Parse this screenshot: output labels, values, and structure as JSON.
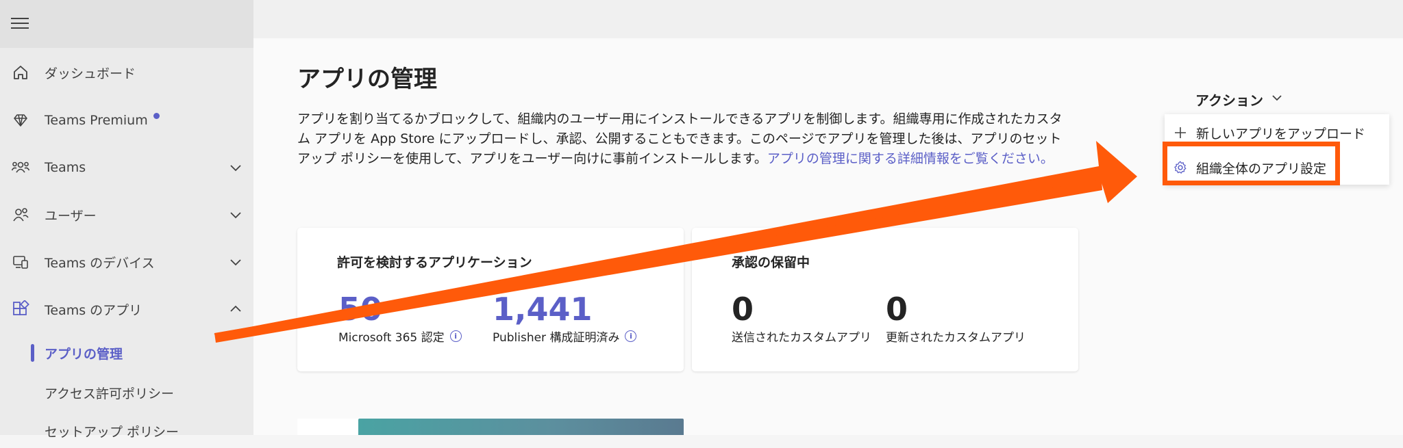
{
  "sidebar": {
    "items": [
      {
        "label": "ダッシュボード"
      },
      {
        "label": "Teams Premium"
      },
      {
        "label": "Teams"
      },
      {
        "label": "ユーザー"
      },
      {
        "label": "Teams のデバイス"
      },
      {
        "label": "Teams のアプリ"
      }
    ],
    "sub_items": [
      {
        "label": "アプリの管理"
      },
      {
        "label": "アクセス許可ポリシー"
      },
      {
        "label": "セットアップ ポリシー"
      }
    ]
  },
  "page": {
    "title": "アプリの管理",
    "description": "アプリを割り当てるかブロックして、組織内のユーザー用にインストールできるアプリを制御します。組織専用に作成されたカスタム アプリを App Store にアップロードし、承認、公開することもできます。このページでアプリを管理した後は、アプリのセットアップ ポリシーを使用して、アプリをユーザー向けに事前インストールします。",
    "learn_more_link": "アプリの管理に関する詳細情報をご覧ください。"
  },
  "cards": [
    {
      "title": "許可を検討するアプリケーション",
      "stats": [
        {
          "value": "50",
          "label": "Microsoft 365 認定"
        },
        {
          "value": "1,441",
          "label": "Publisher 構成証明済み"
        }
      ]
    },
    {
      "title": "承認の保留中",
      "stats": [
        {
          "value": "0",
          "label": "送信されたカスタムアプリ"
        },
        {
          "value": "0",
          "label": "更新されたカスタムアプリ"
        }
      ]
    }
  ],
  "actions": {
    "label": "アクション",
    "menu": [
      {
        "label": "新しいアプリをアップロード",
        "icon": "plus-icon"
      },
      {
        "label": "組織全体のアプリ設定",
        "icon": "gear-icon"
      }
    ]
  },
  "colors": {
    "accent": "#5b5fc7",
    "annotation": "#ff5a0a"
  }
}
